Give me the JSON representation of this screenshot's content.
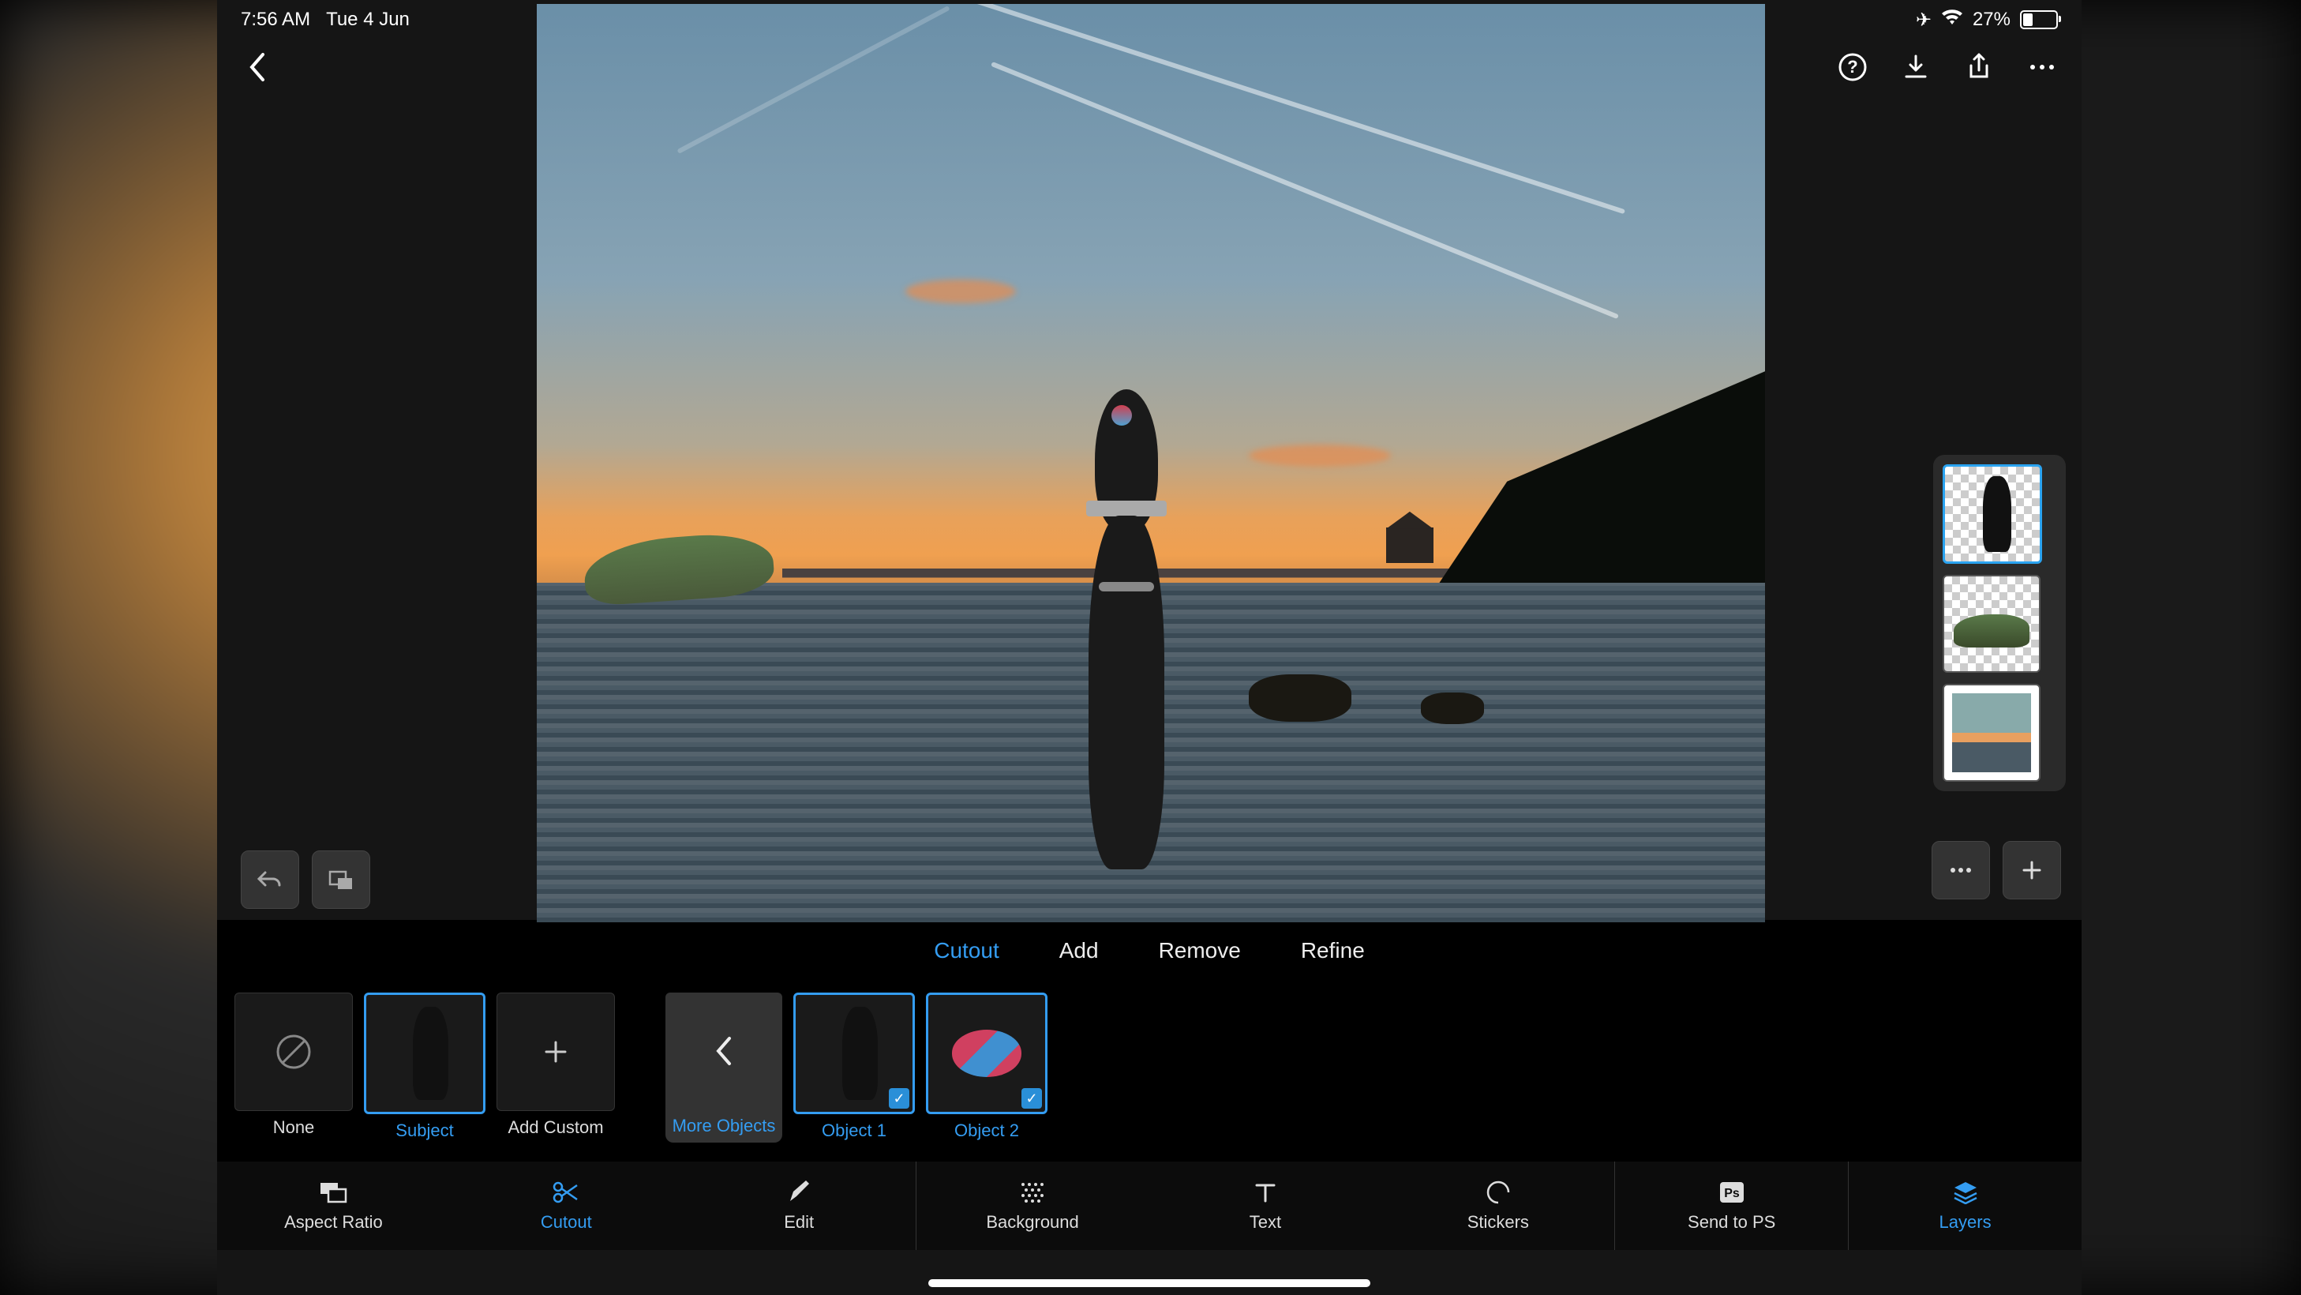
{
  "status": {
    "time": "7:56 AM",
    "date": "Tue 4 Jun",
    "battery": "27%",
    "airplane_icon": "airplane",
    "wifi_icon": "wifi"
  },
  "topbar": {
    "back_icon": "chevron-left",
    "help_icon": "question-circle",
    "download_icon": "download",
    "share_icon": "share",
    "more_icon": "ellipsis"
  },
  "canvas_buttons": {
    "undo_icon": "undo",
    "transform_icon": "transform"
  },
  "layers": {
    "items": [
      {
        "name": "layer-dog",
        "selected": true
      },
      {
        "name": "layer-island",
        "selected": false
      },
      {
        "name": "layer-background",
        "selected": false
      }
    ],
    "more_icon": "ellipsis",
    "add_icon": "plus"
  },
  "tabs": [
    {
      "label": "Cutout",
      "active": true
    },
    {
      "label": "Add",
      "active": false
    },
    {
      "label": "Remove",
      "active": false
    },
    {
      "label": "Refine",
      "active": false
    }
  ],
  "thumbs": {
    "none": {
      "label": "None",
      "icon": "circle-slash"
    },
    "subject": {
      "label": "Subject",
      "selected": true
    },
    "add_custom": {
      "label": "Add Custom",
      "icon": "plus"
    },
    "more_objects": {
      "label": "More Objects",
      "icon": "chevron-left"
    },
    "objects": [
      {
        "label": "Object 1",
        "selected": true,
        "checked": true
      },
      {
        "label": "Object 2",
        "selected": true,
        "checked": true
      }
    ]
  },
  "bottom": [
    {
      "label": "Aspect Ratio",
      "icon": "aspect-ratio",
      "active": false
    },
    {
      "label": "Cutout",
      "icon": "scissors",
      "active": true
    },
    {
      "label": "Edit",
      "icon": "pencil",
      "active": false
    },
    {
      "label": "Background",
      "icon": "dots-grid",
      "active": false
    },
    {
      "label": "Text",
      "icon": "text",
      "active": false
    },
    {
      "label": "Stickers",
      "icon": "circle",
      "active": false
    },
    {
      "label": "Send to PS",
      "icon": "ps",
      "active": false
    },
    {
      "label": "Layers",
      "icon": "layers",
      "active": true
    }
  ]
}
